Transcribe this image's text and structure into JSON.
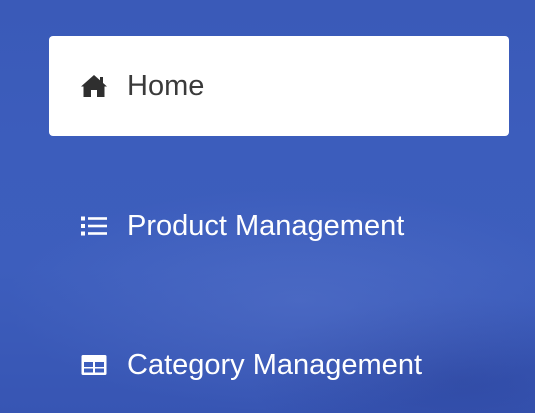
{
  "sidebar": {
    "items": [
      {
        "label": "Home",
        "icon": "home-icon",
        "active": true
      },
      {
        "label": "Product Management",
        "icon": "list-icon",
        "active": false
      },
      {
        "label": "Category Management",
        "icon": "table-icon",
        "active": false
      }
    ]
  },
  "colors": {
    "sidebar_background": "#3d5ebd",
    "active_item_background": "#ffffff",
    "active_item_text": "#3a3a3a",
    "item_text": "#ffffff"
  }
}
